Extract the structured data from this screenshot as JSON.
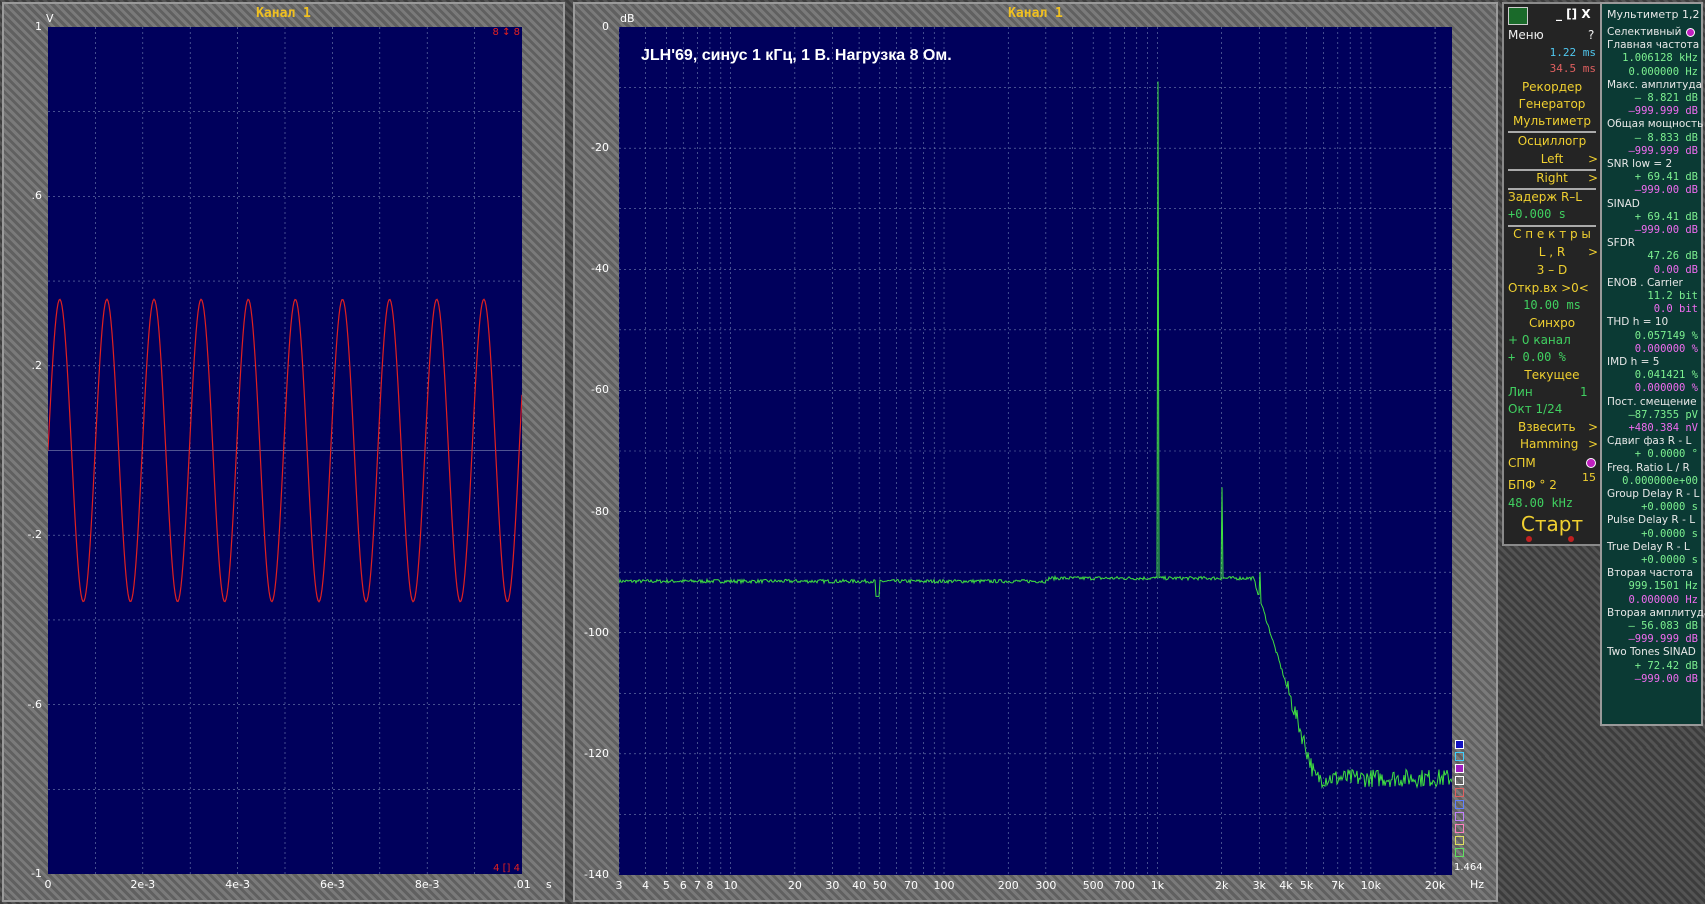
{
  "osc": {
    "title": "Канал 1",
    "y_unit": "V",
    "y_ticks": [
      "1",
      ".6",
      ".2",
      "-.2",
      "-.6",
      "-1"
    ],
    "x_ticks": [
      "0",
      "2e-3",
      "4e-3",
      "6e-3",
      "8e-3",
      ".01"
    ],
    "x_unit": "s",
    "marker_top": "8 ↕ 8",
    "marker_bottom": "4 [] 4",
    "trace_color": "#e02020"
  },
  "spec": {
    "title": "Канал 1",
    "y_unit": "dB",
    "annotation": "JLH'69, синус 1 кГц, 1 В. Нагрузка 8 Ом.",
    "y_ticks": [
      "0",
      "-20",
      "-40",
      "-60",
      "-80",
      "-100",
      "-120",
      "-140"
    ],
    "x_ticks": [
      "3",
      "4",
      "5",
      "6",
      "7",
      "8",
      "10",
      "20",
      "30",
      "40",
      "50",
      "70",
      "100",
      "200",
      "300",
      "500",
      "700",
      "1k",
      "2k",
      "3k",
      "4k",
      "5k",
      "7k",
      "10k",
      "20k"
    ],
    "x_unit": "Hz",
    "corner_value": "1.464",
    "trace_color": "#40e040"
  },
  "controls": {
    "title_buttons": "_ [] X",
    "menu": "Меню",
    "help": "?",
    "time1": "1.22 ms",
    "time2": "34.5 ms",
    "recorder": "Рекордер",
    "generator": "Генератор",
    "multimeter": "Мультиметр",
    "oscillograph": "Осциллогр",
    "left": "Left",
    "right": "Right",
    "arrow": ">",
    "delay_label": "Задерж  R–L",
    "delay_value": "+0.000  s",
    "spectra": "С п е к т р ы",
    "lr": "L , R",
    "three_d": "3 – D",
    "open_input": "Откр.вх >0<",
    "open_value": "10.00 ms",
    "sync": "Синхро",
    "sync_channel": "+ 0 канал",
    "sync_percent": "+ 0.00 %",
    "current": "Текущее",
    "lin": "Лин",
    "lin_value": "1",
    "oct": "Окт  1/24",
    "weigh": "Взвесить",
    "window": "Hamming",
    "spm": "СПМ",
    "fft": "БПФ ° 2",
    "fft_exp": "15",
    "sample_rate": "48.00 kHz",
    "start": "Старт"
  },
  "meter": {
    "title": "Мультиметр 1,2",
    "rows": [
      {
        "label": "Селективный"
      },
      {
        "label": "Главная частота"
      },
      {
        "value": "1.006128 kHz",
        "cls": "g"
      },
      {
        "value": "0.000000  Hz",
        "cls": "g"
      },
      {
        "label": "Макс. амплитуда"
      },
      {
        "value": "–   8.821 dB",
        "cls": "g"
      },
      {
        "value": "–999.999 dB",
        "cls": "p"
      },
      {
        "label": "Общая мощность"
      },
      {
        "value": "–   8.833 dB",
        "cls": "g"
      },
      {
        "value": "–999.999 dB",
        "cls": "p"
      },
      {
        "label": "SNR      low =  2"
      },
      {
        "value": "+  69.41 dB",
        "cls": "g"
      },
      {
        "value": "–999.00 dB",
        "cls": "p"
      },
      {
        "label": "SINAD"
      },
      {
        "value": "+  69.41 dB",
        "cls": "g"
      },
      {
        "value": "–999.00 dB",
        "cls": "p"
      },
      {
        "label": "SFDR"
      },
      {
        "value": "47.26 dB",
        "cls": "g"
      },
      {
        "value": "0.00 dB",
        "cls": "p"
      },
      {
        "label": "ENOB . Carrier"
      },
      {
        "value": "11.2 bit",
        "cls": "g"
      },
      {
        "value": "0.0 bit",
        "cls": "p"
      },
      {
        "label": "THD        h =  10"
      },
      {
        "value": "0.057149 %",
        "cls": "g"
      },
      {
        "value": "0.000000 %",
        "cls": "p"
      },
      {
        "label": "IMD         h =   5"
      },
      {
        "value": "0.041421 %",
        "cls": "g"
      },
      {
        "value": "0.000000 %",
        "cls": "p"
      },
      {
        "label": "Пост. смещение"
      },
      {
        "value": "–87.7355 pV",
        "cls": "g"
      },
      {
        "value": "+480.384 nV",
        "cls": "p"
      },
      {
        "label": "Сдвиг фаз R - L"
      },
      {
        "value": "+  0.0000 °",
        "cls": "g"
      },
      {
        "label": "Freq. Ratio  L / R"
      },
      {
        "value": "0.000000e+00",
        "cls": "g"
      },
      {
        "label": "Group Delay R - L"
      },
      {
        "value": "+0.0000  s",
        "cls": "g"
      },
      {
        "label": "Pulse Delay R - L"
      },
      {
        "value": "+0.0000  s",
        "cls": "g"
      },
      {
        "label": "True  Delay R - L"
      },
      {
        "value": "+0.0000  s",
        "cls": "g"
      },
      {
        "label": "Вторая частота"
      },
      {
        "value": "999.1501  Hz",
        "cls": "g"
      },
      {
        "value": "0.000000  Hz",
        "cls": "p"
      },
      {
        "label": "Вторая амплитуда"
      },
      {
        "value": "–  56.083 dB",
        "cls": "g"
      },
      {
        "value": "–999.999 dB",
        "cls": "p"
      },
      {
        "label": "Two Tones SINAD"
      },
      {
        "value": "+  72.42 dB",
        "cls": "g"
      },
      {
        "value": "–999.00 dB",
        "cls": "p"
      }
    ]
  }
}
